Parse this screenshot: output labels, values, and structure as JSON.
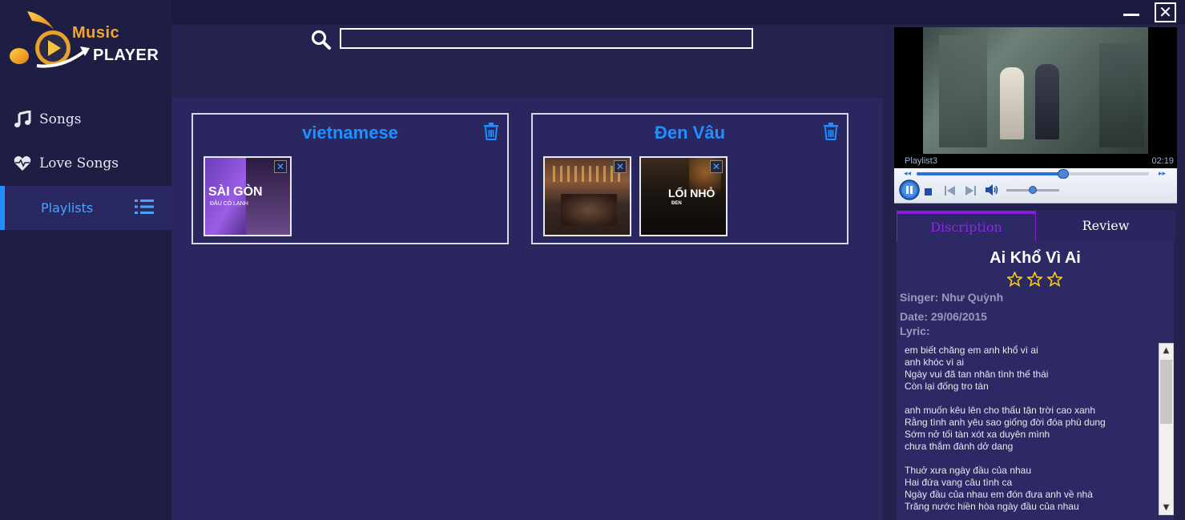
{
  "app": {
    "logo_line1": "Music",
    "logo_line2": "PLAYER"
  },
  "sidebar": {
    "items": [
      {
        "label": "Songs",
        "icon": "music-note-icon"
      },
      {
        "label": "Love Songs",
        "icon": "heart-pulse-icon"
      },
      {
        "label": "Playlists",
        "icon": "list-icon",
        "active": true
      }
    ]
  },
  "window": {
    "close_label": "✕"
  },
  "search": {
    "value": "",
    "placeholder": ""
  },
  "playlists": [
    {
      "title": "vietnamese",
      "tracks": [
        {
          "art_text": "SÀI GÒN",
          "art_subtext": "ĐÂU CÓ LẠNH"
        }
      ]
    },
    {
      "title": "Đen Vâu",
      "tracks": [
        {
          "art_text": ""
        },
        {
          "art_text": "LỐI NHỎ",
          "art_subtext": "ĐEN"
        }
      ]
    }
  ],
  "player": {
    "video_label": "Playlist3",
    "time": "02:19",
    "progress_fraction": 0.63,
    "volume_fraction": 0.5
  },
  "tabs": {
    "description": "Discription",
    "review": "Review"
  },
  "song": {
    "title": "Ai Khổ Vì Ai",
    "rating": 3,
    "singer": "Singer: Như Quỳnh",
    "date": "Date: 29/06/2015",
    "lyric_label": "Lyric:",
    "lyrics": "em biết chăng em anh khổ vì ai\nanh khóc vì ai\nNgày vui đã tan nhân tình thế thái\nCòn lại đống tro tàn\n\nanh muốn kêu lên cho thấu tận trời cao xanh\nRằng tình anh yêu sao giống đời đóa phù dung\nSớm nở tối tàn xót xa duyên mình\nchưa thắm đành dở dang\n\nThuở xưa ngày đầu của nhau\nHai đứa vang câu tình ca\nNgày đầu của nhau em đón đưa anh về nhà\nTrăng nước hiền hòa ngày đầu của nhau"
  },
  "colors": {
    "accent": "#1e90ff",
    "tab_active": "#8a2be2",
    "logo_orange": "#f5a623"
  }
}
